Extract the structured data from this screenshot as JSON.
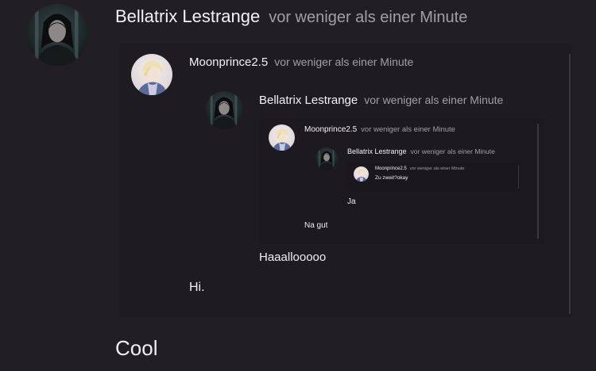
{
  "post": {
    "author": "Bellatrix Lestrange",
    "time": "vor weniger als einer Minute",
    "text": "Cool",
    "avatar_icon": "dark-haired-portrait-avatar",
    "quote": {
      "author": "Moonprince2.5",
      "time": "vor weniger als einer Minute",
      "text": "Hi.",
      "avatar_icon": "blonde-portrait-avatar",
      "quote": {
        "author": "Bellatrix Lestrange",
        "time": "vor weniger als einer Minute",
        "text": "Haaallooooo",
        "avatar_icon": "dark-haired-portrait-avatar",
        "quote": {
          "author": "Moonprince2.5",
          "time": "vor weniger als einer Minute",
          "text": "Na gut",
          "avatar_icon": "blonde-portrait-avatar",
          "quote": {
            "author": "Bellatrix Lestrange",
            "time": "vor weniger als einer Minute",
            "text": "Ja",
            "avatar_icon": "dark-haired-portrait-avatar",
            "quote": {
              "author": "Moonprince2.5",
              "time": "vor weniger als einer Minute",
              "text": "Zu zweit?okay",
              "avatar_icon": "blonde-portrait-avatar"
            }
          }
        }
      }
    }
  },
  "colors": {
    "background": "#221f24",
    "quote_background": "#1f1c21",
    "quote_border": "#3a373e",
    "name_text": "#f4f2f6",
    "time_text": "#a29ea8"
  }
}
